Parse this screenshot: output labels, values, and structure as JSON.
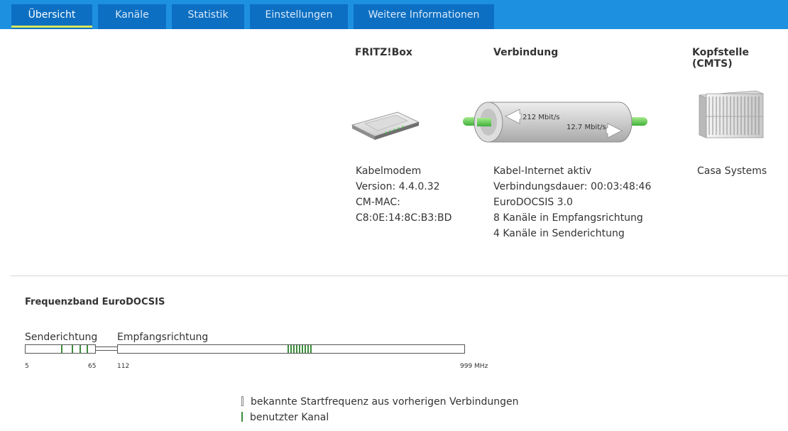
{
  "tabs": [
    {
      "label": "Übersicht",
      "active": true
    },
    {
      "label": "Kanäle",
      "active": false
    },
    {
      "label": "Statistik",
      "active": false
    },
    {
      "label": "Einstellungen",
      "active": false
    },
    {
      "label": "Weitere Informationen",
      "active": false
    }
  ],
  "columns": {
    "fritzbox": {
      "title": "FRITZ!Box",
      "icon": "router-icon",
      "lines": [
        "Kabelmodem",
        "Version: 4.4.0.32",
        "CM-MAC:",
        "C8:0E:14:8C:B3:BD"
      ]
    },
    "connection": {
      "title": "Verbindung",
      "icon": "cable-pipe-icon",
      "downstream_rate": "212 Mbit/s",
      "upstream_rate": "12.7 Mbit/s",
      "lines": [
        "Kabel-Internet aktiv",
        "Verbindungsdauer: 00:03:48:46",
        "EuroDOCSIS 3.0",
        "8 Kanäle in Empfangsrichtung",
        "4 Kanäle in Senderichtung"
      ]
    },
    "cmts": {
      "title": "Kopfstelle (CMTS)",
      "icon": "server-rack-icon",
      "lines": [
        "Casa Systems"
      ]
    }
  },
  "frequency": {
    "title": "Frequenzband EuroDOCSIS",
    "send_label": "Senderichtung",
    "receive_label": "Empfangsrichtung",
    "ticks": {
      "send_start": "5",
      "send_end": "65",
      "receive_start": "112",
      "receive_end": "999 MHz"
    }
  },
  "legend": [
    {
      "label": "bekannte Startfrequenz aus vorherigen Verbindungen",
      "color": "#888888"
    },
    {
      "label": "benutzter Kanal",
      "color": "#3c8c3c"
    }
  ],
  "colors": {
    "tabbar": "#1e90e0",
    "tab": "#0d6fc2",
    "active_underline": "#d7e85b",
    "channel": "#3c8c3c"
  }
}
